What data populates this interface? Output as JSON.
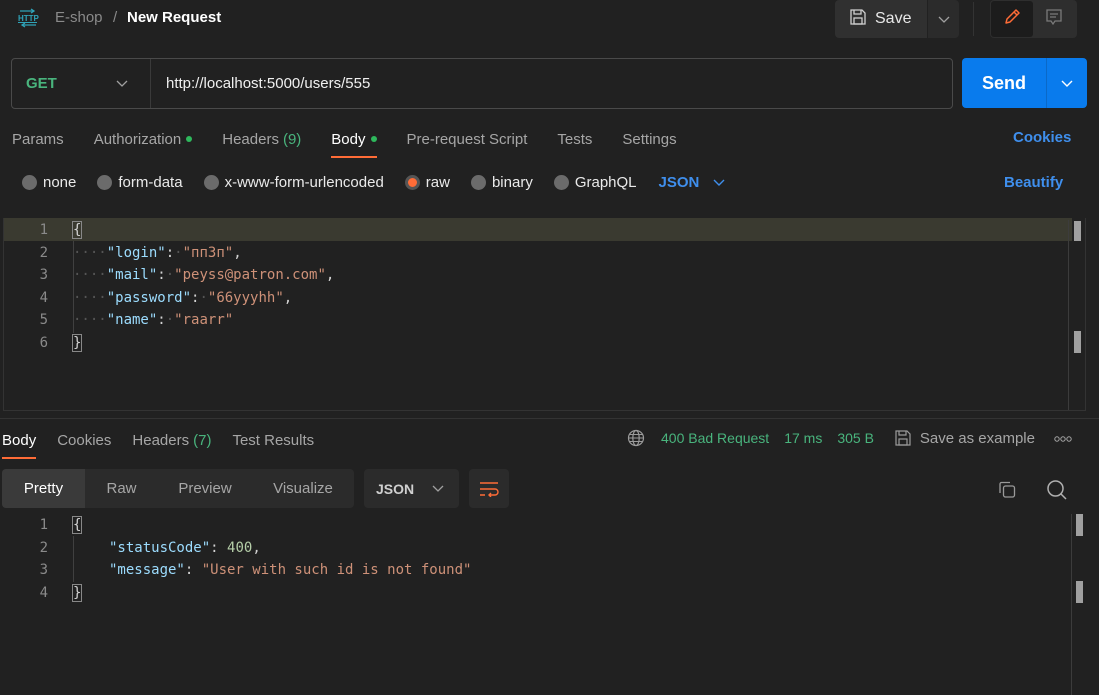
{
  "header": {
    "app_icon": "http-icon",
    "breadcrumb_parent": "E-shop",
    "breadcrumb_separator": "/",
    "title": "New Request",
    "save_label": "Save",
    "save_icon": "floppy-disk-icon",
    "save_dropdown_icon": "chevron-down-icon",
    "mode_buttons": [
      {
        "icon": "pencil-icon",
        "active": true
      },
      {
        "icon": "comment-icon",
        "active": false
      }
    ]
  },
  "request": {
    "method": "GET",
    "url": "http://localhost:5000/users/555",
    "send_label": "Send",
    "colors": {
      "method": "#49b47d",
      "send": "#097bed",
      "accent": "#ff6c37",
      "link": "#3f8fed"
    }
  },
  "request_tabs": [
    {
      "label": "Params",
      "dot": false,
      "count": null,
      "active": false
    },
    {
      "label": "Authorization",
      "dot": true,
      "count": null,
      "active": false
    },
    {
      "label": "Headers",
      "dot": false,
      "count": "(9)",
      "active": false
    },
    {
      "label": "Body",
      "dot": true,
      "count": null,
      "active": true
    },
    {
      "label": "Pre-request Script",
      "dot": false,
      "count": null,
      "active": false
    },
    {
      "label": "Tests",
      "dot": false,
      "count": null,
      "active": false
    },
    {
      "label": "Settings",
      "dot": false,
      "count": null,
      "active": false
    }
  ],
  "cookies_link": "Cookies",
  "body_types": [
    {
      "label": "none",
      "selected": false
    },
    {
      "label": "form-data",
      "selected": false
    },
    {
      "label": "x-www-form-urlencoded",
      "selected": false
    },
    {
      "label": "raw",
      "selected": true
    },
    {
      "label": "binary",
      "selected": false
    },
    {
      "label": "GraphQL",
      "selected": false
    }
  ],
  "raw_format": "JSON",
  "beautify_label": "Beautify",
  "request_body": {
    "line_numbers": [
      "1",
      "2",
      "3",
      "4",
      "5",
      "6"
    ],
    "open_brace": "{",
    "close_brace": "}",
    "fields": [
      {
        "key": "\"login\"",
        "value": "\"пп3п\"",
        "comma": ","
      },
      {
        "key": "\"mail\"",
        "value": "\"peyss@patron.com\"",
        "comma": ","
      },
      {
        "key": "\"password\"",
        "value": "\"66yyyhh\"",
        "comma": ","
      },
      {
        "key": "\"name\"",
        "value": "\"raarr\"",
        "comma": ""
      }
    ]
  },
  "response": {
    "tabs": [
      {
        "label": "Body",
        "count": null,
        "active": true
      },
      {
        "label": "Cookies",
        "count": null,
        "active": false
      },
      {
        "label": "Headers",
        "count": "(7)",
        "active": false
      },
      {
        "label": "Test Results",
        "count": null,
        "active": false
      }
    ],
    "globe_icon": "globe-icon",
    "status": "400 Bad Request",
    "time": "17 ms",
    "size": "305 B",
    "save_example_label": "Save as example",
    "more_label": "ooo",
    "view_tabs": [
      {
        "label": "Pretty",
        "active": true
      },
      {
        "label": "Raw",
        "active": false
      },
      {
        "label": "Preview",
        "active": false
      },
      {
        "label": "Visualize",
        "active": false
      }
    ],
    "format": "JSON",
    "body": {
      "line_numbers": [
        "1",
        "2",
        "3",
        "4"
      ],
      "open_brace": "{",
      "close_brace": "}",
      "status_key": "\"statusCode\"",
      "status_value": "400",
      "message_key": "\"message\"",
      "message_value": "\"User with such id is not found\""
    }
  }
}
